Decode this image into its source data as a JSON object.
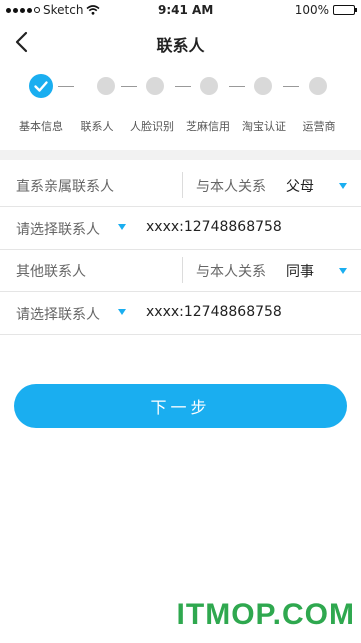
{
  "status_bar": {
    "carrier": "Sketch",
    "time": "9:41 AM",
    "battery": "100%"
  },
  "nav": {
    "title": "联系人",
    "back_icon": "chevron-left-icon"
  },
  "steps": [
    {
      "label": "基本信息",
      "status": "done"
    },
    {
      "label": "联系人",
      "status": "todo"
    },
    {
      "label": "人脸识别",
      "status": "todo"
    },
    {
      "label": "芝麻信用",
      "status": "todo"
    },
    {
      "label": "淘宝认证",
      "status": "todo"
    },
    {
      "label": "运营商",
      "status": "todo"
    }
  ],
  "contacts": [
    {
      "type_label": "直系亲属联系人",
      "relation_label": "与本人关系",
      "relation_value": "父母",
      "select_label": "请选择联系人",
      "phone": "xxxx:12748868758"
    },
    {
      "type_label": "其他联系人",
      "relation_label": "与本人关系",
      "relation_value": "同事",
      "select_label": "请选择联系人",
      "phone": "xxxx:12748868758"
    }
  ],
  "next_button_label": "下一步",
  "watermark": "ITMOP.COM",
  "colors": {
    "accent": "#1aaef0",
    "inactive_step": "#d9d9d9",
    "watermark": "#2fa84f"
  }
}
